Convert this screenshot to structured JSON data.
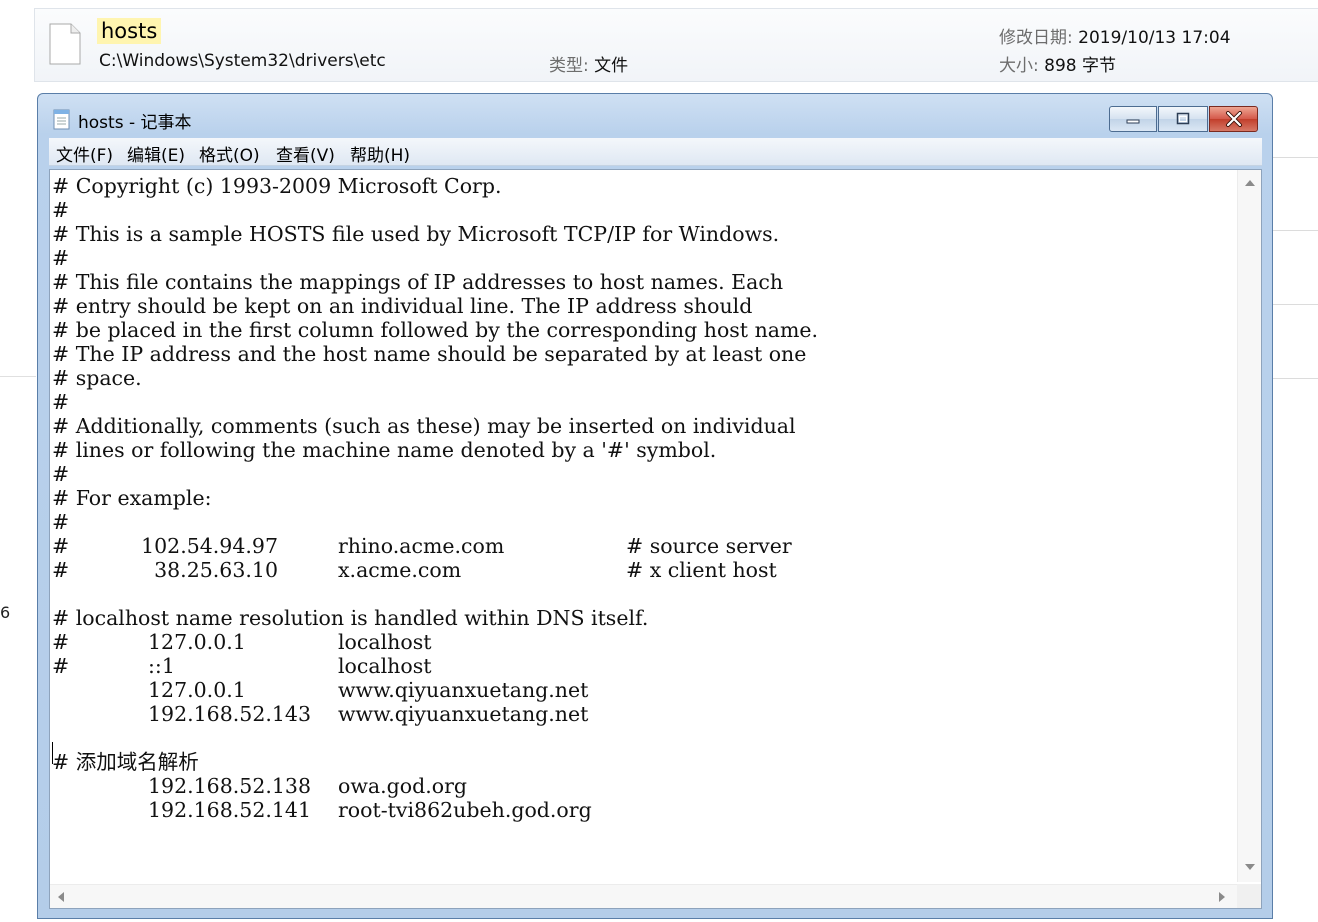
{
  "explorer": {
    "file_name": "hosts",
    "file_path": "C:\\Windows\\System32\\drivers\\etc",
    "type_label": "类型:",
    "type_value": "文件",
    "date_label": "修改日期:",
    "date_value": "2019/10/13 17:04",
    "size_label": "大小:",
    "size_value": "898 字节",
    "edge_char": "6"
  },
  "window": {
    "title": "hosts - 记事本",
    "icons": {
      "app": "notepad-icon",
      "minimize": "minimize-icon",
      "maximize": "maximize-icon",
      "close": "close-icon"
    },
    "close_color": "#c94531"
  },
  "menu": {
    "items": [
      "文件(F)",
      "编辑(E)",
      "格式(O)",
      "查看(V)",
      "帮助(H)"
    ]
  },
  "editor": {
    "lines": [
      [
        "# Copyright (c) 1993-2009 Microsoft Corp."
      ],
      [
        "#"
      ],
      [
        "# This is a sample HOSTS file used by Microsoft TCP/IP for Windows."
      ],
      [
        "#"
      ],
      [
        "# This file contains the mappings of IP addresses to host names. Each"
      ],
      [
        "# entry should be kept on an individual line. The IP address should"
      ],
      [
        "# be placed in the first column followed by the corresponding host name."
      ],
      [
        "# The IP address and the host name should be separated by at least one"
      ],
      [
        "# space."
      ],
      [
        "#"
      ],
      [
        "# Additionally, comments (such as these) may be inserted on individual"
      ],
      [
        "# lines or following the machine name denoted by a '#' symbol."
      ],
      [
        "#"
      ],
      [
        "# For example:"
      ],
      [
        "#"
      ],
      [
        "#",
        "102.54.94.97",
        "rhino.acme.com",
        "# source server"
      ],
      [
        "#",
        "38.25.63.10",
        "x.acme.com",
        "# x client host"
      ],
      [
        ""
      ],
      [
        "# localhost name resolution is handled within DNS itself."
      ],
      [
        "#",
        "127.0.0.1",
        "localhost"
      ],
      [
        "#",
        "::1",
        "localhost"
      ],
      [
        "",
        "127.0.0.1",
        "www.qiyuanxuetang.net"
      ],
      [
        "",
        "192.168.52.143",
        "www.qiyuanxuetang.net"
      ],
      [
        ""
      ],
      [
        "# 添加域名解析"
      ],
      [
        "",
        "192.168.52.138",
        "owa.god.org"
      ],
      [
        "",
        "192.168.52.141",
        "root-tvi862ubeh.god.org"
      ]
    ]
  }
}
